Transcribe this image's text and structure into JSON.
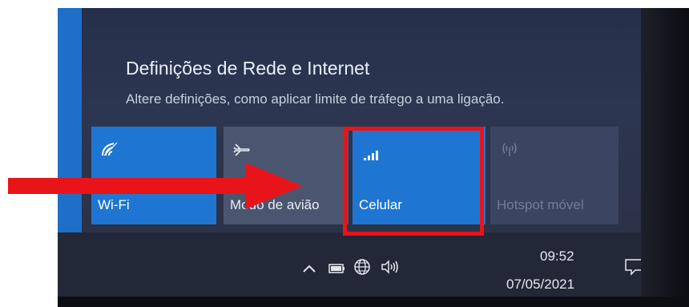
{
  "panel": {
    "title": "Definições de Rede e Internet",
    "subtitle": "Altere definições, como aplicar limite de tráfego a uma ligação."
  },
  "tiles": [
    {
      "label": "Wi-Fi",
      "icon": "wifi-icon",
      "state": "on"
    },
    {
      "label": "Modo de avião",
      "icon": "airplane-icon",
      "state": "off"
    },
    {
      "label": "Celular",
      "icon": "cellular-signal-icon",
      "state": "on"
    },
    {
      "label": "Hotspot móvel",
      "icon": "hotspot-icon",
      "state": "disabled"
    }
  ],
  "taskbar": {
    "time": "09:52",
    "date": "07/05/2021",
    "tray_icons": [
      "chevron-up-icon",
      "battery-icon",
      "network-globe-icon",
      "volume-icon",
      "notification-icon"
    ]
  },
  "annotation": {
    "highlight_color": "#e8141a",
    "highlighted_tile": "Celular"
  },
  "colors": {
    "accent": "#1f76d2",
    "panel_bg": "#2d3650",
    "tile_off": "#4a5670"
  }
}
